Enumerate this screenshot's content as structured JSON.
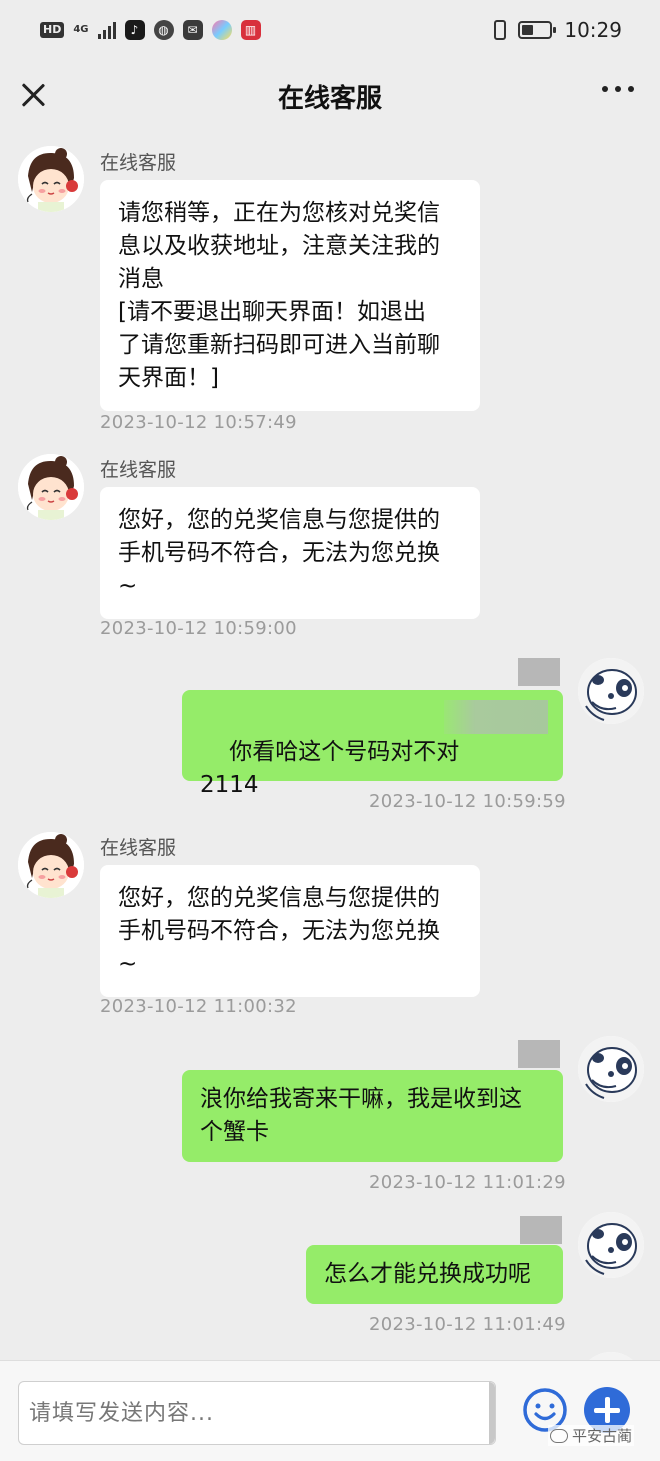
{
  "status_bar": {
    "hd": "HD",
    "network": "4G",
    "time": "10:29"
  },
  "nav": {
    "title": "在线客服"
  },
  "messages": [
    {
      "side": "in",
      "sender": "在线客服",
      "text": "请您稍等，正在为您核对兑奖信\n息以及收获地址，注意关注我的\n消息\n[请不要退出聊天界面！如退出\n了请您重新扫码即可进入当前聊\n天界面！]",
      "time": "2023-10-12 10:57:49"
    },
    {
      "side": "in",
      "sender": "在线客服",
      "text": "您好，您的兑奖信息与您提供的\n手机号码不符合，无法为您兑换\n~",
      "time": "2023-10-12 10:59:00"
    },
    {
      "side": "out",
      "text": "你看哈这个号码对不对\n2114",
      "time": "2023-10-12 10:59:59"
    },
    {
      "side": "in",
      "sender": "在线客服",
      "text": "您好，您的兑奖信息与您提供的\n手机号码不符合，无法为您兑换\n~",
      "time": "2023-10-12 11:00:32"
    },
    {
      "side": "out",
      "text": "浪你给我寄来干嘛，我是收到这\n个蟹卡",
      "time": "2023-10-12 11:01:29"
    },
    {
      "side": "out",
      "text": "怎么才能兑换成功呢",
      "time": "2023-10-12 11:01:49"
    }
  ],
  "input": {
    "placeholder": "请填写发送内容..."
  },
  "watermark": "平安古蔺",
  "colors": {
    "background": "#ededed",
    "outgoing_bubble": "#95ec69",
    "incoming_bubble": "#ffffff",
    "plus_button": "#2f6bd8",
    "emoji_button": "#2f6bd8"
  }
}
